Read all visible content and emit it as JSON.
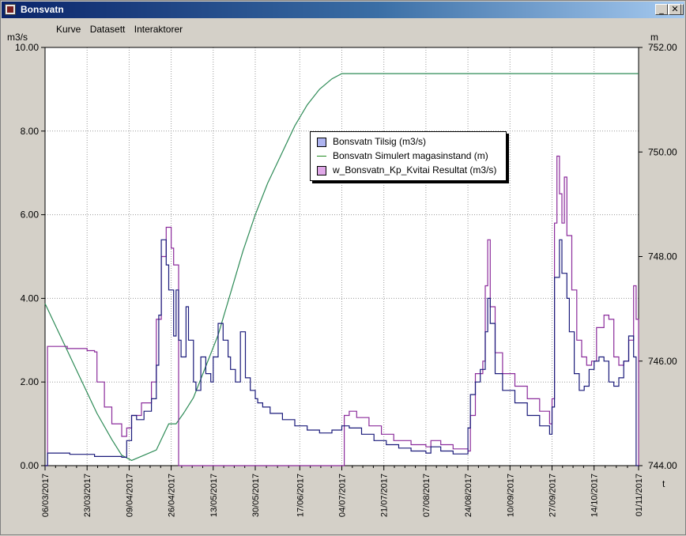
{
  "window": {
    "title": "Bonsvatn",
    "buttons": [
      "_",
      "□",
      "✕"
    ]
  },
  "menu": [
    "Kurve",
    "Datasett",
    "Interaktorer"
  ],
  "colors": {
    "tilsig": "#1a1a7a",
    "magasin": "#2e8b57",
    "resultat": "#8b2b9b",
    "grid": "#9a9a9a"
  },
  "chart_data": {
    "type": "line",
    "y_left_unit": "m3/s",
    "y_right_unit": "m",
    "x_unit": "t",
    "y_left_range": [
      0,
      10
    ],
    "y_right_range": [
      744,
      752
    ],
    "y_left_ticks": [
      "0.00",
      "2.00",
      "4.00",
      "6.00",
      "8.00",
      "10.00"
    ],
    "y_right_ticks": [
      "744.00",
      "746.00",
      "748.00",
      "750.00",
      "752.00"
    ],
    "x_range": [
      "06/03/2017",
      "01/11/2017"
    ],
    "x_ticks": [
      "06/03/2017",
      "23/03/2017",
      "09/04/2017",
      "26/04/2017",
      "13/05/2017",
      "30/05/2017",
      "17/06/2017",
      "04/07/2017",
      "21/07/2017",
      "07/08/2017",
      "24/08/2017",
      "10/09/2017",
      "27/09/2017",
      "14/10/2017",
      "01/11/2017"
    ],
    "grid": "dotted",
    "legend_position": "center-right",
    "series": [
      {
        "name": "Bonsvatn Tilsig (m3/s)",
        "axis": "left",
        "style": "step",
        "x": [
          "06/03/2017",
          "07/03/2017",
          "16/03/2017",
          "26/03/2017",
          "06/04/2017",
          "08/04/2017",
          "10/04/2017",
          "12/04/2017",
          "15/04/2017",
          "18/04/2017",
          "20/04/2017",
          "21/04/2017",
          "22/04/2017",
          "24/04/2017",
          "25/04/2017",
          "27/04/2017",
          "28/04/2017",
          "29/04/2017",
          "30/04/2017",
          "02/05/2017",
          "03/05/2017",
          "05/05/2017",
          "06/05/2017",
          "08/05/2017",
          "10/05/2017",
          "12/05/2017",
          "13/05/2017",
          "15/05/2017",
          "17/05/2017",
          "19/05/2017",
          "20/05/2017",
          "22/05/2017",
          "24/05/2017",
          "26/05/2017",
          "28/05/2017",
          "30/05/2017",
          "31/05/2017",
          "02/06/2017",
          "05/06/2017",
          "10/06/2017",
          "15/06/2017",
          "20/06/2017",
          "25/06/2017",
          "30/06/2017",
          "04/07/2017",
          "07/07/2017",
          "12/07/2017",
          "17/07/2017",
          "22/07/2017",
          "27/07/2017",
          "01/08/2017",
          "07/08/2017",
          "09/08/2017",
          "13/08/2017",
          "18/08/2017",
          "24/08/2017",
          "25/08/2017",
          "27/08/2017",
          "29/08/2017",
          "31/08/2017",
          "01/09/2017",
          "02/09/2017",
          "04/09/2017",
          "07/09/2017",
          "12/09/2017",
          "17/09/2017",
          "22/09/2017",
          "26/09/2017",
          "27/09/2017",
          "28/09/2017",
          "30/09/2017",
          "01/10/2017",
          "03/10/2017",
          "04/10/2017",
          "06/10/2017",
          "08/10/2017",
          "10/10/2017",
          "12/10/2017",
          "14/10/2017",
          "16/10/2017",
          "18/10/2017",
          "20/10/2017",
          "22/10/2017",
          "24/10/2017",
          "26/10/2017",
          "28/10/2017",
          "30/10/2017",
          "31/10/2017",
          "01/11/2017"
        ],
        "y": [
          0.0,
          0.3,
          0.27,
          0.22,
          0.2,
          0.6,
          1.2,
          1.1,
          1.3,
          1.6,
          2.4,
          3.6,
          5.4,
          4.8,
          4.2,
          3.1,
          4.2,
          3.0,
          2.6,
          3.8,
          3.0,
          2.0,
          1.8,
          2.6,
          2.2,
          2.0,
          2.6,
          3.4,
          3.0,
          2.6,
          2.3,
          2.0,
          3.2,
          2.1,
          1.8,
          1.6,
          1.5,
          1.4,
          1.25,
          1.1,
          0.95,
          0.85,
          0.78,
          0.85,
          0.95,
          0.9,
          0.75,
          0.6,
          0.5,
          0.42,
          0.35,
          0.3,
          0.45,
          0.35,
          0.28,
          0.9,
          1.7,
          2.0,
          2.3,
          3.2,
          4.0,
          3.4,
          2.2,
          1.8,
          1.5,
          1.2,
          0.95,
          0.75,
          1.4,
          4.5,
          5.4,
          4.6,
          4.0,
          3.2,
          2.2,
          1.8,
          1.9,
          2.3,
          2.5,
          2.6,
          2.5,
          2.0,
          1.9,
          2.1,
          2.5,
          3.1,
          2.6,
          0.0,
          0.0
        ]
      },
      {
        "name": "Bonsvatn Simulert magasinstand (m)",
        "axis": "right",
        "style": "line",
        "x": [
          "06/03/2017",
          "13/03/2017",
          "20/03/2017",
          "27/03/2017",
          "02/04/2017",
          "06/04/2017",
          "10/04/2017",
          "15/04/2017",
          "20/04/2017",
          "22/04/2017",
          "25/04/2017",
          "28/04/2017",
          "01/05/2017",
          "05/05/2017",
          "10/05/2017",
          "15/05/2017",
          "20/05/2017",
          "25/05/2017",
          "30/05/2017",
          "04/06/2017",
          "10/06/2017",
          "15/06/2017",
          "20/06/2017",
          "25/06/2017",
          "30/06/2017",
          "04/07/2017",
          "06/07/2017",
          "15/07/2017",
          "01/08/2017",
          "20/08/2017",
          "10/09/2017",
          "01/10/2017",
          "20/10/2017",
          "01/11/2017"
        ],
        "y": [
          747.1,
          746.4,
          745.7,
          745.0,
          744.5,
          744.2,
          744.1,
          744.2,
          744.3,
          744.5,
          744.8,
          744.8,
          745.0,
          745.3,
          745.9,
          746.5,
          747.3,
          748.1,
          748.8,
          749.4,
          750.0,
          750.5,
          750.9,
          751.2,
          751.4,
          751.5,
          751.5,
          751.5,
          751.5,
          751.5,
          751.5,
          751.5,
          751.5,
          751.5
        ]
      },
      {
        "name": "w_Bonsvatn_Kp_Kvitai Resultat (m3/s)",
        "axis": "left",
        "style": "step",
        "x": [
          "06/03/2017",
          "07/03/2017",
          "15/03/2017",
          "23/03/2017",
          "26/03/2017",
          "27/03/2017",
          "30/03/2017",
          "02/04/2017",
          "06/04/2017",
          "08/04/2017",
          "10/04/2017",
          "14/04/2017",
          "18/04/2017",
          "20/04/2017",
          "22/04/2017",
          "24/04/2017",
          "26/04/2017",
          "27/04/2017",
          "29/04/2017",
          "30/04/2017",
          "01/05/2017",
          "05/05/2017",
          "15/05/2017",
          "01/06/2017",
          "15/06/2017",
          "01/07/2017",
          "04/07/2017",
          "05/07/2017",
          "07/07/2017",
          "10/07/2017",
          "15/07/2017",
          "20/07/2017",
          "25/07/2017",
          "01/08/2017",
          "07/08/2017",
          "09/08/2017",
          "13/08/2017",
          "18/08/2017",
          "24/08/2017",
          "25/08/2017",
          "27/08/2017",
          "30/08/2017",
          "31/08/2017",
          "01/09/2017",
          "02/09/2017",
          "04/09/2017",
          "07/09/2017",
          "12/09/2017",
          "17/09/2017",
          "22/09/2017",
          "26/09/2017",
          "27/09/2017",
          "28/09/2017",
          "29/09/2017",
          "30/09/2017",
          "01/10/2017",
          "02/10/2017",
          "03/10/2017",
          "05/10/2017",
          "07/10/2017",
          "09/10/2017",
          "11/10/2017",
          "13/10/2017",
          "15/10/2017",
          "18/10/2017",
          "20/10/2017",
          "22/10/2017",
          "24/10/2017",
          "26/10/2017",
          "28/10/2017",
          "30/10/2017",
          "31/10/2017",
          "01/11/2017"
        ],
        "y": [
          0.0,
          2.85,
          2.8,
          2.75,
          2.72,
          2.0,
          1.4,
          1.0,
          0.7,
          0.9,
          1.2,
          1.5,
          2.0,
          3.5,
          5.0,
          5.7,
          5.2,
          4.8,
          0.0,
          0.0,
          0.0,
          0.0,
          0.0,
          0.0,
          0.0,
          0.0,
          0.0,
          1.2,
          1.3,
          1.15,
          0.95,
          0.75,
          0.6,
          0.5,
          0.45,
          0.6,
          0.5,
          0.4,
          0.35,
          1.2,
          2.2,
          2.5,
          4.3,
          5.4,
          3.8,
          2.7,
          2.2,
          1.9,
          1.6,
          1.3,
          1.0,
          1.6,
          5.8,
          7.4,
          6.5,
          5.8,
          6.9,
          5.5,
          4.2,
          3.0,
          2.6,
          2.4,
          2.5,
          3.3,
          3.6,
          3.5,
          2.6,
          2.4,
          2.5,
          3.0,
          4.3,
          3.5,
          0.0
        ]
      }
    ]
  }
}
